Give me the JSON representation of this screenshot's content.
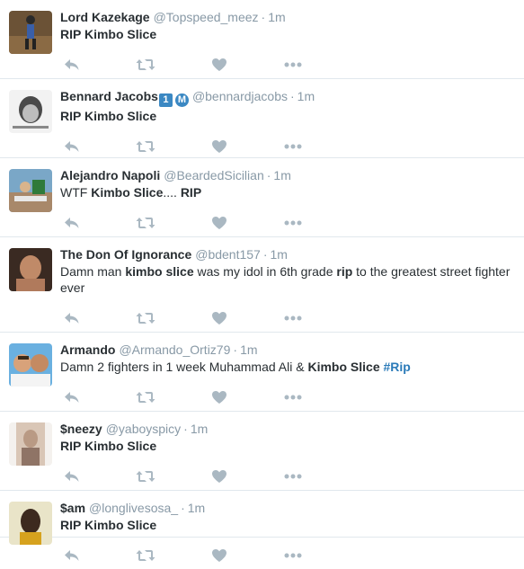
{
  "tweets": [
    {
      "name": "Lord Kazekage",
      "handle": "@Topspeed_meez",
      "time": "1m",
      "parts": [
        {
          "t": "RIP Kimbo Slice",
          "b": true
        }
      ]
    },
    {
      "name": "Bennard Jacobs",
      "badge1": "1",
      "badge2": "M",
      "handle": "@bennardjacobs",
      "time": "1m",
      "parts": [
        {
          "t": "RIP Kimbo Slice",
          "b": true
        }
      ]
    },
    {
      "name": "Alejandro Napoli",
      "handle": "@BeardedSicilian",
      "time": "1m",
      "parts": [
        {
          "t": "WTF "
        },
        {
          "t": "Kimbo Slice",
          "b": true
        },
        {
          "t": ".... "
        },
        {
          "t": "RIP",
          "b": true
        }
      ]
    },
    {
      "name": "The Don Of Ignorance",
      "handle": "@bdent157",
      "time": "1m",
      "parts": [
        {
          "t": "Damn man "
        },
        {
          "t": "kimbo slice",
          "b": true
        },
        {
          "t": " was my idol in 6th grade "
        },
        {
          "t": "rip",
          "b": true
        },
        {
          "t": " to the greatest street fighter ever"
        }
      ]
    },
    {
      "name": "Armando",
      "handle": "@Armando_Ortiz79",
      "time": "1m",
      "parts": [
        {
          "t": "Damn 2 fighters in 1 week Muhammad Ali & "
        },
        {
          "t": "Kimbo Slice",
          "b": true
        },
        {
          "t": " "
        },
        {
          "t": "#Rip",
          "h": true
        }
      ]
    },
    {
      "name": "$neezy",
      "handle": "@yaboyspicy",
      "time": "1m",
      "parts": [
        {
          "t": "RIP Kimbo Slice",
          "b": true
        }
      ]
    },
    {
      "name": "$am",
      "handle": "@longlivesosa_",
      "time": "1m",
      "parts": [
        {
          "t": "RIP Kimbo Slice",
          "b": true
        }
      ]
    }
  ],
  "separator": "·",
  "actions": [
    "reply-icon",
    "retweet-icon",
    "like-icon",
    "more-icon"
  ],
  "colors": {
    "name": "#292f33",
    "meta": "#8899a6",
    "action": "#aab8c2",
    "hashtag": "#2b7bb9",
    "badge": "#3b88c3",
    "divider": "#e1e8ed"
  }
}
